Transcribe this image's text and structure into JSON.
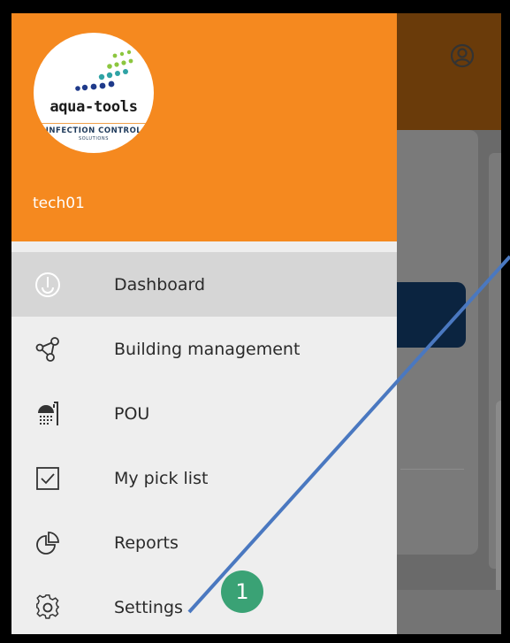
{
  "drawer": {
    "logo": {
      "brand": "aqua-tools",
      "tagline": "INFECTION CONTROL",
      "subtagline": "SOLUTIONS"
    },
    "username": "tech01"
  },
  "menu": {
    "items": [
      {
        "label": "Dashboard",
        "icon": "dashboard-icon",
        "active": true
      },
      {
        "label": "Building management",
        "icon": "building-management-icon",
        "active": false
      },
      {
        "label": "POU",
        "icon": "shower-icon",
        "active": false
      },
      {
        "label": "My pick list",
        "icon": "checkbox-icon",
        "active": false
      },
      {
        "label": "Reports",
        "icon": "pie-chart-icon",
        "active": false
      },
      {
        "label": "Settings",
        "icon": "gear-icon",
        "active": false
      }
    ]
  },
  "annotation": {
    "step": "1",
    "badge_color": "#3aa275",
    "line_color": "#4a78c0"
  },
  "colors": {
    "header": "#f5891f",
    "active_item": "#d6d6d6"
  }
}
